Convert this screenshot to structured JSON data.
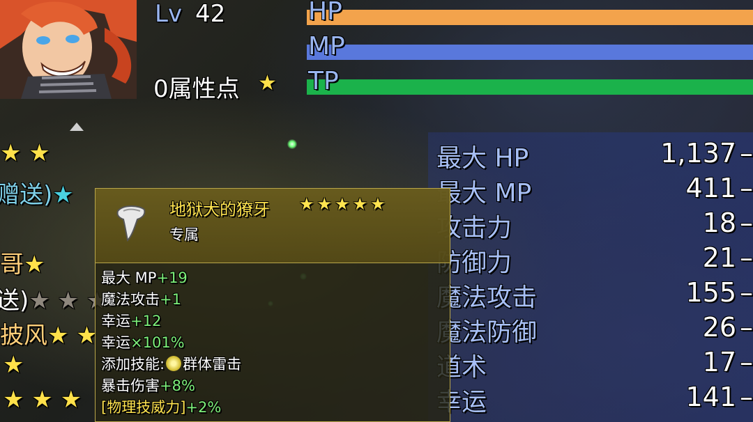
{
  "header": {
    "lv_label": "Lv",
    "lv_value": "42",
    "attr_points": "0属性点",
    "attr_star": "★"
  },
  "bars": [
    {
      "label": "HP",
      "fill": 1.0,
      "color": "#f3a34c"
    },
    {
      "label": "MP",
      "fill": 1.0,
      "color": "#5978dc"
    },
    {
      "label": "TP",
      "fill": 1.0,
      "color": "#1bb24b"
    }
  ],
  "left_list": [
    {
      "text": "",
      "stars": "★ ★"
    },
    {
      "text": "赠送)",
      "stars": "★"
    },
    {
      "text": "哥",
      "stars": "★"
    },
    {
      "text": "送)",
      "stars": "★ ★ ★"
    },
    {
      "text": "披风",
      "stars": "★ ★"
    },
    {
      "text": "",
      "stars": "★"
    },
    {
      "text": "",
      "stars": "★ ★ ★"
    }
  ],
  "stats": [
    {
      "label": "最大 HP",
      "value": "1,137",
      "dash": "–"
    },
    {
      "label": "最大 MP",
      "value": "411",
      "dash": "–"
    },
    {
      "label": "攻击力",
      "value": "18",
      "dash": "–"
    },
    {
      "label": "防御力",
      "value": "21",
      "dash": "–"
    },
    {
      "label": "魔法攻击",
      "value": "155",
      "dash": "–"
    },
    {
      "label": "魔法防御",
      "value": "26",
      "dash": "–"
    },
    {
      "label": "道术",
      "value": "17",
      "dash": "–"
    },
    {
      "label": "幸运",
      "value": "141",
      "dash": "–"
    }
  ],
  "tooltip": {
    "title": "地狱犬的獠牙",
    "stars": "★★★★★",
    "subtitle": "专属",
    "icon": "fang-icon",
    "lines": [
      {
        "label": "最大 MP",
        "bonus": "+19"
      },
      {
        "label": "魔法攻击",
        "bonus": "+1"
      },
      {
        "label": "幸运",
        "bonus": "+12"
      },
      {
        "label": "幸运",
        "bonus": "×101%"
      },
      {
        "label": "添加技能:",
        "skill": "群体雷击"
      },
      {
        "label": "暴击伤害",
        "bonus": "+8%"
      },
      {
        "label": "[物理技威力]",
        "bonus": "+2%"
      }
    ]
  },
  "colors": {
    "accent": "#ffe14a",
    "stat_label": "#a7bff5",
    "bonus_green": "#7ef07a"
  }
}
